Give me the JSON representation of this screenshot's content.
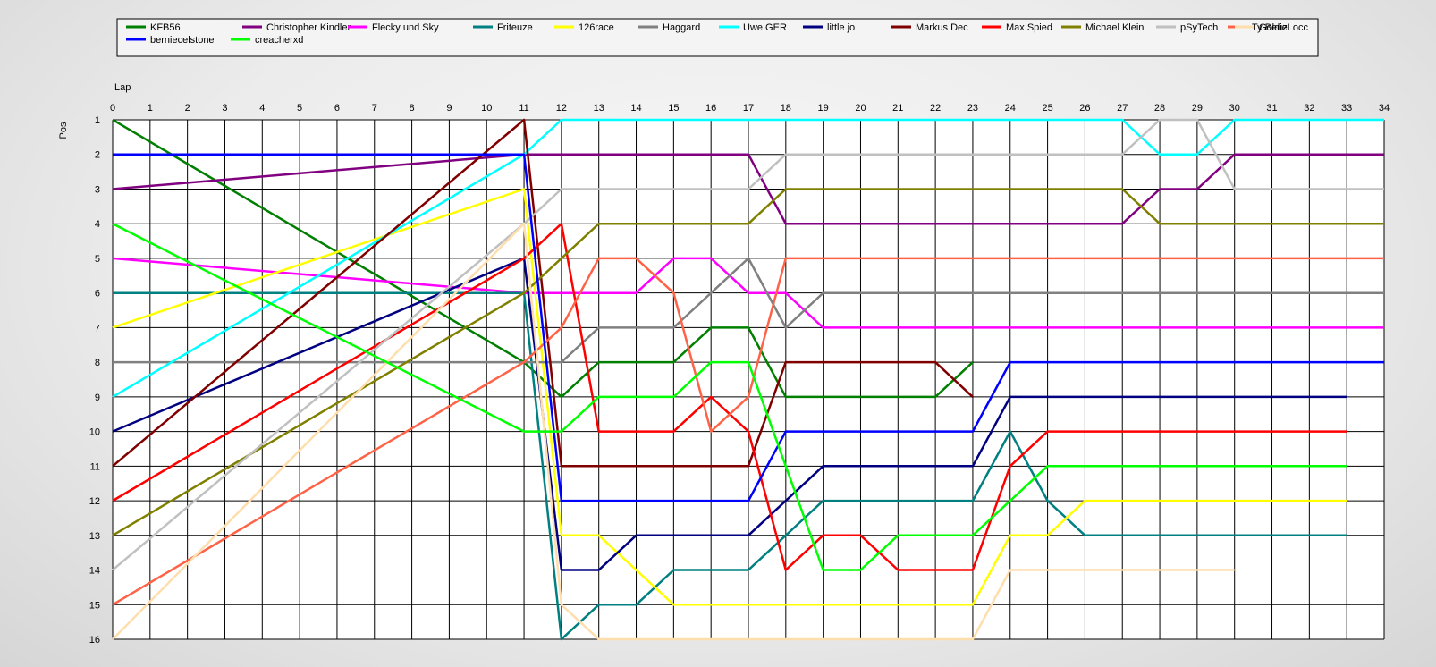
{
  "chart_data": {
    "type": "line",
    "xlabel": "Lap",
    "ylabel": "Pos",
    "xlim": [
      0,
      34
    ],
    "ylim": [
      1,
      16
    ],
    "y_inverted": true,
    "grid": true,
    "legend_position": "top",
    "x_ticks": [
      0,
      1,
      2,
      3,
      4,
      5,
      6,
      7,
      8,
      9,
      10,
      11,
      12,
      13,
      14,
      15,
      16,
      17,
      18,
      19,
      20,
      21,
      22,
      23,
      24,
      25,
      26,
      27,
      28,
      29,
      30,
      31,
      32,
      33,
      34
    ],
    "y_ticks": [
      1,
      2,
      3,
      4,
      5,
      6,
      7,
      8,
      9,
      10,
      11,
      12,
      13,
      14,
      15,
      16
    ],
    "series": [
      {
        "name": "KFB56",
        "color": "#008000",
        "x": [
          0,
          11,
          12,
          13,
          14,
          15,
          16,
          17,
          18,
          19,
          20,
          21,
          22,
          23
        ],
        "y": [
          1,
          8,
          9,
          8,
          8,
          8,
          7,
          7,
          9,
          9,
          9,
          9,
          9,
          8
        ]
      },
      {
        "name": "Christopher Kindler",
        "color": "#800080",
        "x": [
          0,
          11,
          12,
          13,
          14,
          15,
          16,
          17,
          18,
          19,
          20,
          21,
          22,
          23,
          24,
          25,
          26,
          27,
          28,
          29,
          30,
          31,
          32,
          33,
          34
        ],
        "y": [
          3,
          2,
          2,
          2,
          2,
          2,
          2,
          2,
          4,
          4,
          4,
          4,
          4,
          4,
          4,
          4,
          4,
          4,
          3,
          3,
          2,
          2,
          2,
          2,
          2
        ]
      },
      {
        "name": "Flecky und Sky",
        "color": "#FF00FF",
        "x": [
          0,
          11,
          12,
          13,
          14,
          15,
          16,
          17,
          18,
          19,
          20,
          21,
          22,
          23,
          24,
          25,
          26,
          27,
          28,
          29,
          30,
          31,
          32,
          33,
          34
        ],
        "y": [
          5,
          6,
          6,
          6,
          6,
          5,
          5,
          6,
          6,
          7,
          7,
          7,
          7,
          7,
          7,
          7,
          7,
          7,
          7,
          7,
          7,
          7,
          7,
          7,
          7
        ]
      },
      {
        "name": "Friteuze",
        "color": "#008080",
        "x": [
          0,
          11,
          12,
          13,
          14,
          15,
          16,
          17,
          18,
          19,
          20,
          21,
          22,
          23,
          24,
          25,
          26,
          27,
          28,
          29,
          30,
          31,
          32,
          33
        ],
        "y": [
          6,
          6,
          16,
          15,
          15,
          14,
          14,
          14,
          13,
          12,
          12,
          12,
          12,
          12,
          10,
          12,
          13,
          13,
          13,
          13,
          13,
          13,
          13,
          13
        ]
      },
      {
        "name": "126race",
        "color": "#FFFF00",
        "x": [
          0,
          11,
          12,
          13,
          14,
          15,
          16,
          17,
          18,
          19,
          20,
          21,
          22,
          23,
          24,
          25,
          26,
          27,
          28,
          29,
          30,
          31,
          32,
          33
        ],
        "y": [
          7,
          3,
          13,
          13,
          14,
          15,
          15,
          15,
          15,
          15,
          15,
          15,
          15,
          15,
          13,
          13,
          12,
          12,
          12,
          12,
          12,
          12,
          12,
          12
        ]
      },
      {
        "name": "Haggard",
        "color": "#808080",
        "x": [
          0,
          11,
          12,
          13,
          14,
          15,
          16,
          17,
          18,
          19,
          20,
          21,
          22,
          23,
          24,
          25,
          26,
          27,
          28,
          29,
          30,
          31,
          32,
          33,
          34
        ],
        "y": [
          8,
          8,
          8,
          7,
          7,
          7,
          6,
          5,
          7,
          6,
          6,
          6,
          6,
          6,
          6,
          6,
          6,
          6,
          6,
          6,
          6,
          6,
          6,
          6,
          6
        ]
      },
      {
        "name": "Uwe GER",
        "color": "#00FFFF",
        "x": [
          0,
          11,
          12,
          13,
          14,
          15,
          16,
          17,
          18,
          19,
          20,
          21,
          22,
          23,
          24,
          25,
          26,
          27,
          28,
          29,
          30,
          31,
          32,
          33,
          34
        ],
        "y": [
          9,
          2,
          1,
          1,
          1,
          1,
          1,
          1,
          1,
          1,
          1,
          1,
          1,
          1,
          1,
          1,
          1,
          1,
          2,
          2,
          1,
          1,
          1,
          1,
          1
        ]
      },
      {
        "name": "little jo",
        "color": "#000080",
        "x": [
          0,
          11,
          12,
          13,
          14,
          15,
          16,
          17,
          18,
          19,
          20,
          21,
          22,
          23,
          24,
          25,
          26,
          27,
          28,
          29,
          30,
          31,
          32,
          33
        ],
        "y": [
          10,
          5,
          14,
          14,
          13,
          13,
          13,
          13,
          12,
          11,
          11,
          11,
          11,
          11,
          9,
          9,
          9,
          9,
          9,
          9,
          9,
          9,
          9,
          9
        ]
      },
      {
        "name": "Markus Dec",
        "color": "#800000",
        "x": [
          0,
          11,
          12,
          13,
          14,
          15,
          16,
          17,
          18,
          19,
          20,
          21,
          22,
          23
        ],
        "y": [
          11,
          1,
          11,
          11,
          11,
          11,
          11,
          11,
          8,
          8,
          8,
          8,
          8,
          9
        ]
      },
      {
        "name": "Max Spied",
        "color": "#FF0000",
        "x": [
          0,
          11,
          12,
          13,
          14,
          15,
          16,
          17,
          18,
          19,
          20,
          21,
          22,
          23,
          24,
          25,
          26,
          27,
          28,
          29,
          30,
          31,
          32,
          33
        ],
        "y": [
          12,
          5,
          4,
          10,
          10,
          10,
          9,
          10,
          14,
          13,
          13,
          14,
          14,
          14,
          11,
          10,
          10,
          10,
          10,
          10,
          10,
          10,
          10,
          10
        ]
      },
      {
        "name": "Michael Klein",
        "color": "#808000",
        "x": [
          0,
          11,
          12,
          13,
          14,
          15,
          16,
          17,
          18,
          19,
          20,
          21,
          22,
          23,
          24,
          25,
          26,
          27,
          28,
          29,
          30,
          31,
          32,
          33,
          34
        ],
        "y": [
          13,
          6,
          5,
          4,
          4,
          4,
          4,
          4,
          3,
          3,
          3,
          3,
          3,
          3,
          3,
          3,
          3,
          3,
          4,
          4,
          4,
          4,
          4,
          4,
          4
        ]
      },
      {
        "name": "pSyTech",
        "color": "#C0C0C0",
        "x": [
          0,
          11,
          12,
          13,
          14,
          15,
          16,
          17,
          18,
          19,
          20,
          21,
          22,
          23,
          24,
          25,
          26,
          27,
          28,
          29,
          30,
          31,
          32,
          33,
          34
        ],
        "y": [
          14,
          4,
          3,
          3,
          3,
          3,
          3,
          3,
          2,
          2,
          2,
          2,
          2,
          2,
          2,
          2,
          2,
          2,
          1,
          1,
          3,
          3,
          3,
          3,
          3
        ]
      },
      {
        "name": "Ty Beuz",
        "color": "#FF6347",
        "x": [
          0,
          11,
          12,
          13,
          14,
          15,
          16,
          17,
          18,
          19,
          20,
          21,
          22,
          23,
          24,
          25,
          26,
          27,
          28,
          29,
          30,
          31,
          32,
          33,
          34
        ],
        "y": [
          15,
          8,
          7,
          5,
          5,
          6,
          10,
          9,
          5,
          5,
          5,
          5,
          5,
          5,
          5,
          5,
          5,
          5,
          5,
          5,
          5,
          5,
          5,
          5,
          5
        ]
      },
      {
        "name": "GoldieLocc",
        "color": "#FFDEAD",
        "x": [
          0,
          11,
          12,
          13,
          14,
          15,
          16,
          17,
          18,
          19,
          20,
          21,
          22,
          23,
          24,
          25,
          26,
          27,
          28,
          29,
          30
        ],
        "y": [
          16,
          4,
          15,
          16,
          16,
          16,
          16,
          16,
          16,
          16,
          16,
          16,
          16,
          16,
          14,
          14,
          14,
          14,
          14,
          14,
          14
        ]
      },
      {
        "name": "berniecelstone",
        "color": "#0000FF",
        "x": [
          0,
          11,
          12,
          13,
          14,
          15,
          16,
          17,
          18,
          19,
          20,
          21,
          22,
          23,
          24,
          25,
          26,
          27,
          28,
          29,
          30,
          31,
          32,
          33,
          34
        ],
        "y": [
          2,
          2,
          12,
          12,
          12,
          12,
          12,
          12,
          10,
          10,
          10,
          10,
          10,
          10,
          8,
          8,
          8,
          8,
          8,
          8,
          8,
          8,
          8,
          8,
          8
        ]
      },
      {
        "name": "creacherxd",
        "color": "#00FF00",
        "x": [
          0,
          11,
          12,
          13,
          14,
          15,
          16,
          17,
          18,
          19,
          20,
          21,
          22,
          23,
          24,
          25,
          26,
          27,
          28,
          29,
          30,
          31,
          32,
          33
        ],
        "y": [
          4,
          10,
          10,
          9,
          9,
          9,
          8,
          8,
          11,
          14,
          14,
          13,
          13,
          13,
          12,
          11,
          11,
          11,
          11,
          11,
          11,
          11,
          11,
          11
        ]
      }
    ]
  }
}
